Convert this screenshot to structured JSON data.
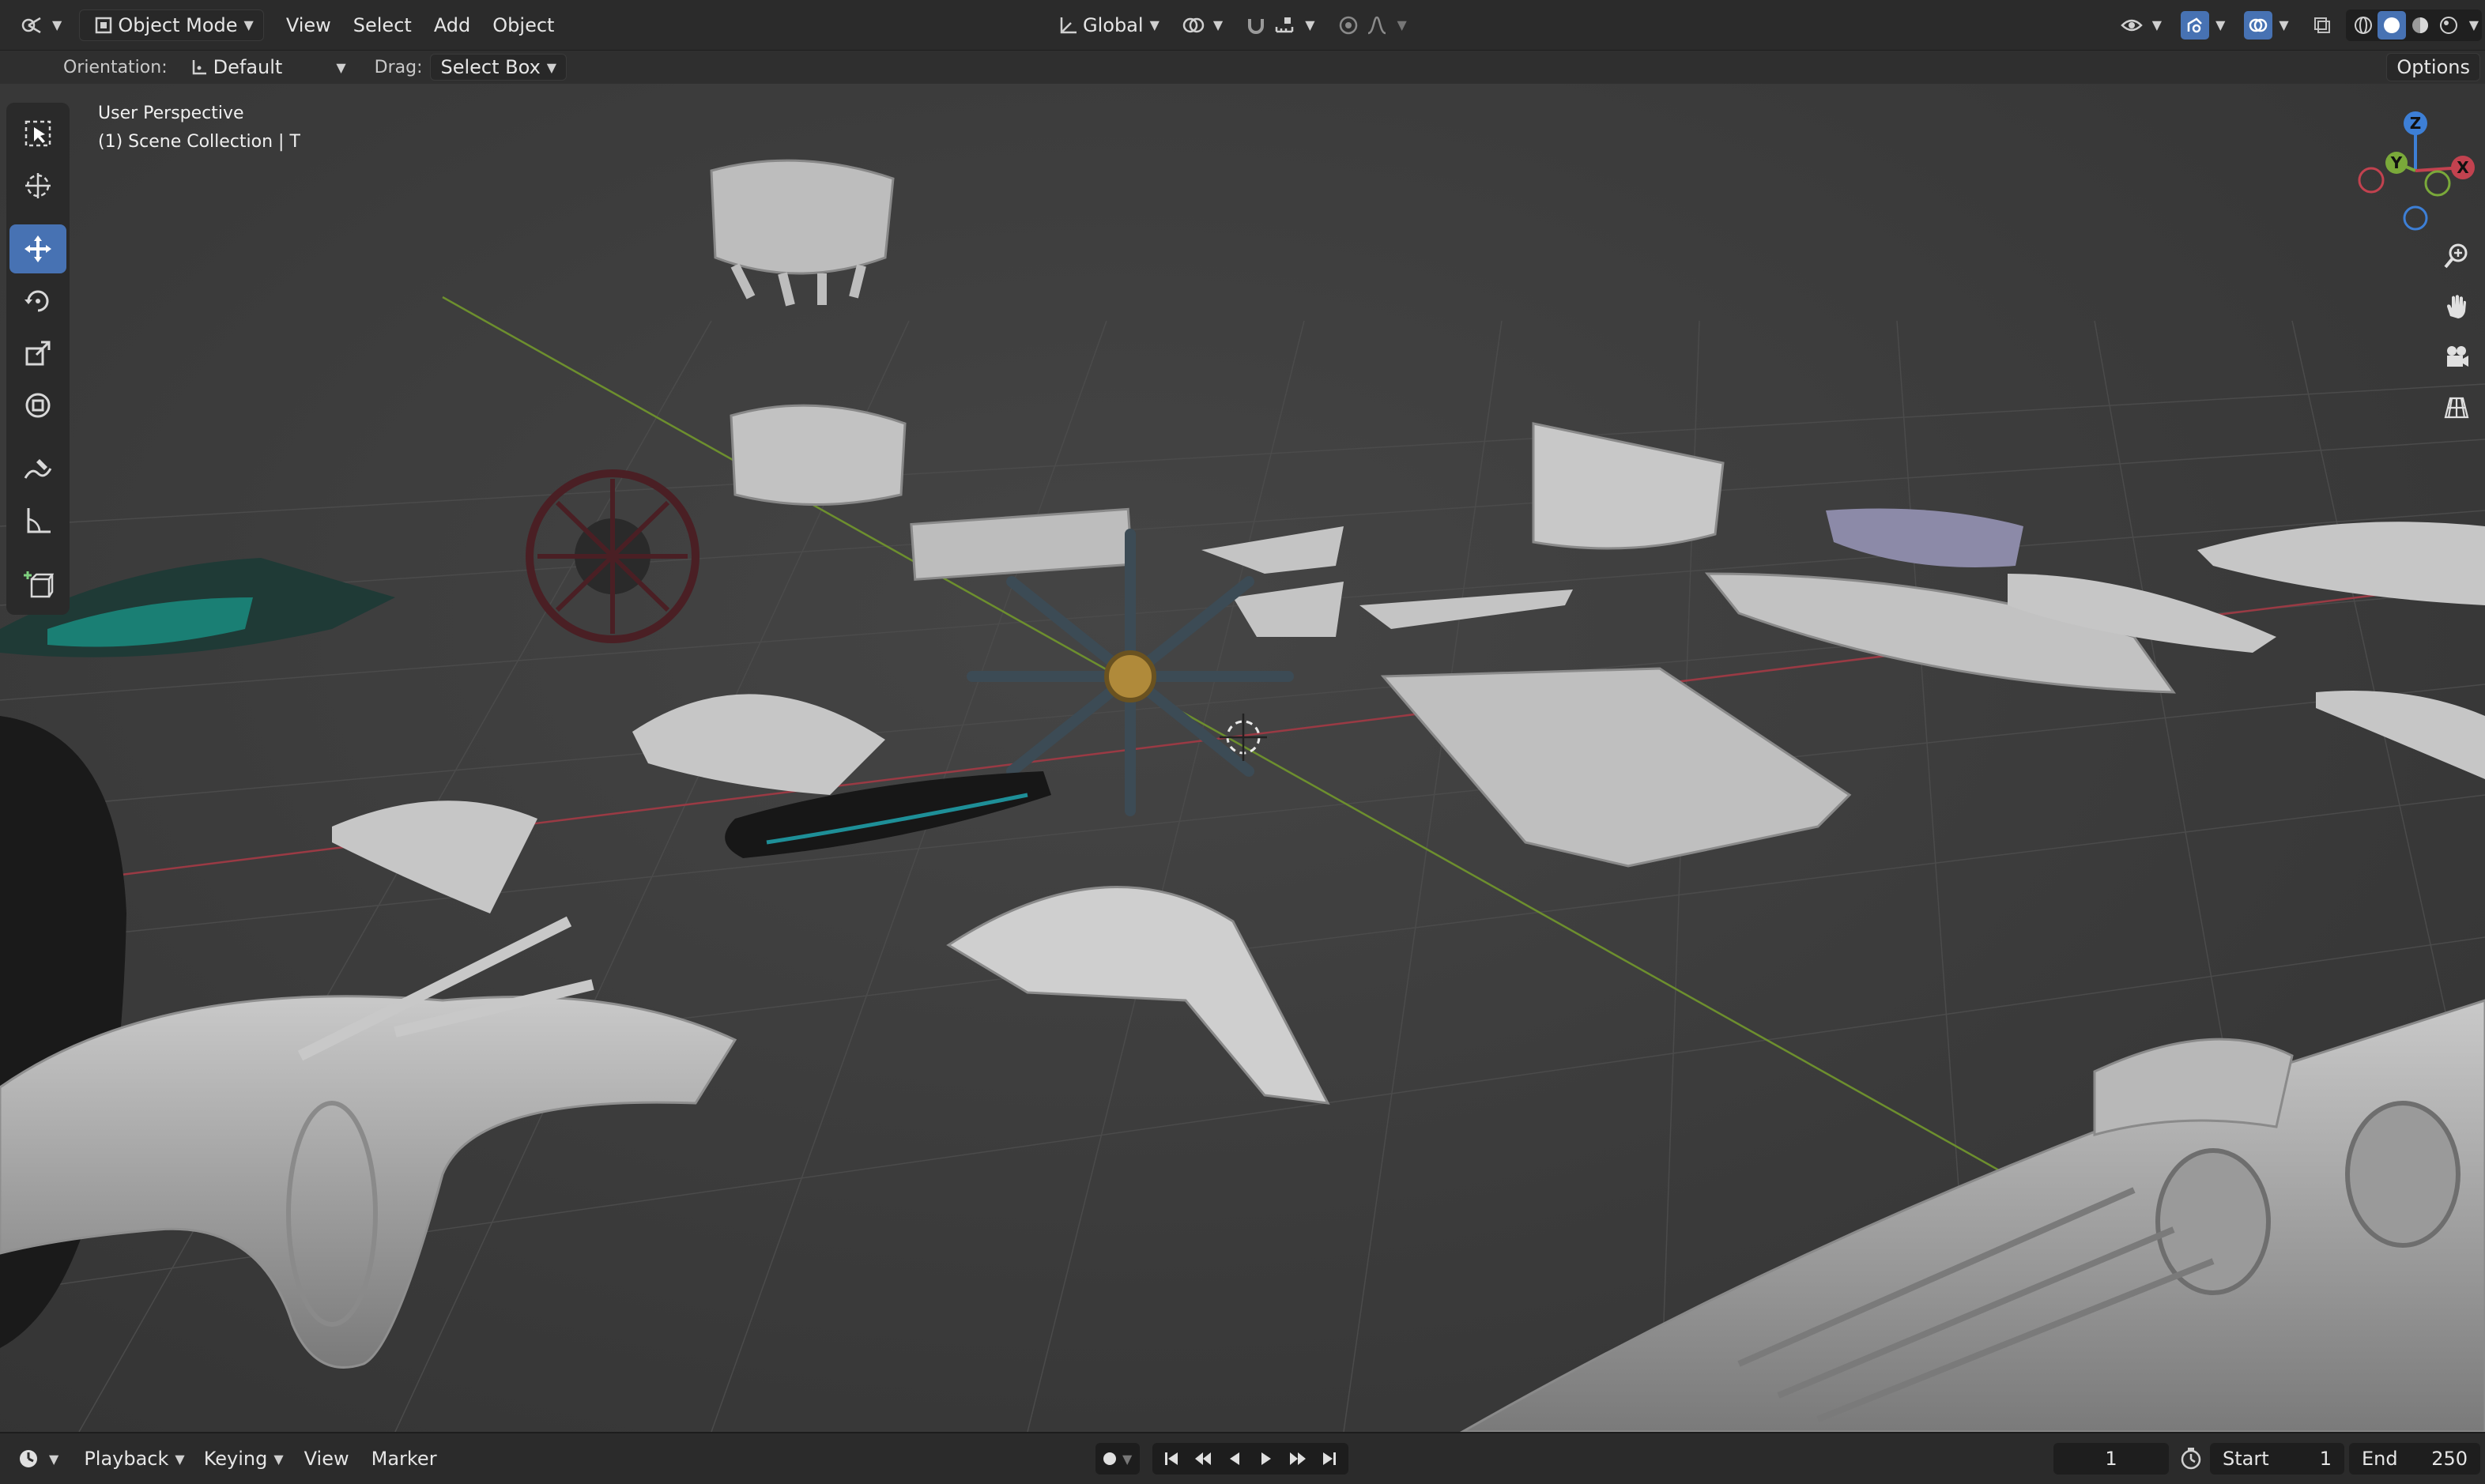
{
  "header": {
    "editor_type_icon": "3d-viewport-icon",
    "mode_label": "Object Mode",
    "menus": [
      "View",
      "Select",
      "Add",
      "Object"
    ],
    "transform_orientation": "Global",
    "options_label": "Options"
  },
  "tool_settings": {
    "orientation_label": "Orientation:",
    "orientation_value": "Default",
    "drag_label": "Drag:",
    "drag_value": "Select Box"
  },
  "viewport": {
    "view_name": "User Perspective",
    "collection_info": "(1) Scene Collection | T",
    "gizmo_axes": [
      "Z",
      "Y",
      "X"
    ],
    "colors": {
      "x_axis": "#c2424f",
      "y_axis": "#7aa93a",
      "z_axis": "#3d7fd6",
      "grid": "#4a4a4a",
      "active_tool": "#4772b3"
    }
  },
  "toolbar": {
    "tools": [
      "select-box-icon",
      "cursor-icon",
      "move-icon",
      "rotate-icon",
      "scale-icon",
      "transform-icon",
      "annotate-icon",
      "measure-icon",
      "add-cube-icon"
    ],
    "active_tool": "move-icon"
  },
  "timeline": {
    "menus": [
      "Playback",
      "Keying",
      "View",
      "Marker"
    ],
    "current_frame": "1",
    "start_label": "Start",
    "start_value": "1",
    "end_label": "End",
    "end_value": "250"
  }
}
